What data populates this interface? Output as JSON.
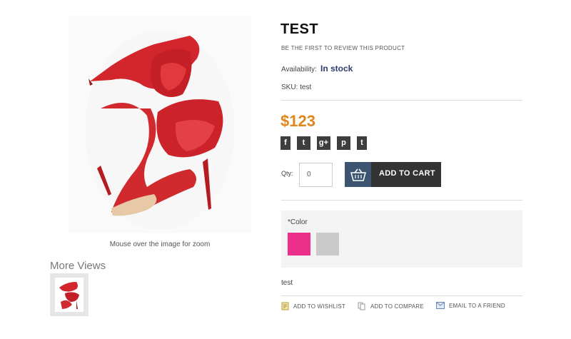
{
  "product": {
    "title": "TEST",
    "review_link": "BE THE FIRST TO REVIEW THIS PRODUCT",
    "availability_label": "Availability:",
    "availability_value": "In stock",
    "sku": "SKU: test",
    "price": "$123",
    "short_description": "test"
  },
  "gallery": {
    "zoom_hint": "Mouse over the image for zoom",
    "more_views_title": "More Views"
  },
  "social": [
    "f",
    "t",
    "g+",
    "p",
    "t"
  ],
  "cart": {
    "qty_label": "Qty:",
    "qty_value": "0",
    "add_to_cart_label": "ADD TO CART"
  },
  "options": {
    "color_label": "*Color",
    "colors": [
      "#ec2f8a",
      "#c9c9c9"
    ]
  },
  "links": {
    "wishlist": "ADD TO WISHLIST",
    "compare": "ADD TO COMPARE",
    "email": "EMAIL TO A FRIEND"
  },
  "theme": {
    "price_color": "#e0861c",
    "stock_color": "#2b3d6d",
    "cart_icon_bg": "#3c5470",
    "button_bg": "#333333"
  }
}
